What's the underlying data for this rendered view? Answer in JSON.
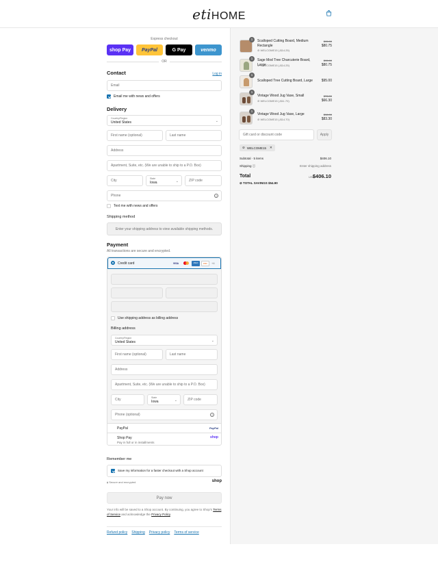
{
  "header": {
    "logo_script": "eti",
    "logo_text": "HOME",
    "cart_icon": "shopping-bag-icon"
  },
  "express": {
    "label": "Express checkout",
    "shop_pay": "shop Pay",
    "paypal": "PayPal",
    "gpay": "G Pay",
    "venmo": "venmo",
    "or": "OR"
  },
  "contact": {
    "title": "Contact",
    "login": "Log in",
    "email_placeholder": "Email",
    "newsletter": "Email me with news and offers"
  },
  "delivery": {
    "title": "Delivery",
    "country_label": "Country/Region",
    "country": "United States",
    "first_name": "First name (optional)",
    "last_name": "Last name",
    "address": "Address",
    "apartment": "Apartment, Suite, etc. (We are unable to ship to a P.O. Box)",
    "city": "City",
    "state_label": "State",
    "state": "Iowa",
    "zip": "ZIP code",
    "phone": "Phone",
    "text_me": "Text me with news and offers"
  },
  "shipping": {
    "title": "Shipping method",
    "placeholder": "Enter your shipping address to view available shipping methods."
  },
  "payment": {
    "title": "Payment",
    "subtitle": "All transactions are secure and encrypted.",
    "credit_card": "Credit card",
    "card_brands": [
      "VISA",
      "MC",
      "AMEX",
      "DISC",
      "+4"
    ],
    "use_shipping": "Use shipping address as billing address",
    "billing_title": "Billing address",
    "paypal": "PayPal",
    "paypal_logo": "PayPal",
    "shop_pay": "Shop Pay",
    "shop_pay_sub": "Pay in full or in installments",
    "shop_logo": "shop"
  },
  "billing": {
    "country_label": "Country/Region",
    "country": "United States",
    "first_name": "First name (optional)",
    "last_name": "Last name",
    "address": "Address",
    "apartment": "Apartment, Suite, etc. (We are unable to ship to a P.O. Box)",
    "city": "City",
    "state_label": "State",
    "state": "Iowa",
    "zip": "ZIP code",
    "phone": "Phone (optional)"
  },
  "remember": {
    "title": "Remember me",
    "save": "Save my information for a faster checkout with a Shop account",
    "secure": "Secure and encrypted",
    "shop": "shop"
  },
  "pay_now": "Pay now",
  "legal": {
    "text1": "Your info will be saved to a Shop account. By continuing, you agree to Shop's",
    "terms": "Terms of Service",
    "and": "and acknowledge the",
    "privacy": "Privacy Policy",
    "period": "."
  },
  "footer": [
    "Refund policy",
    "Shipping",
    "Privacy policy",
    "Terms of service"
  ],
  "cart": {
    "items": [
      {
        "qty": "1",
        "name": "Scalloped Cutting Board, Medium Rectangle",
        "discount": "WELCOME15 (-$14.25)",
        "old": "$95.00",
        "new": "$80.75"
      },
      {
        "qty": "1",
        "name": "Sage Mod Tree Charcuterie Board, Large",
        "discount": "WELCOME15 (-$14.25)",
        "old": "$95.00",
        "new": "$80.75"
      },
      {
        "qty": "1",
        "name": "Scalloped Tree Cutting Board, Large",
        "discount": "",
        "old": "",
        "new": "$95.00"
      },
      {
        "qty": "1",
        "name": "Vintage Wood Jug Vase, Small",
        "discount": "WELCOME15 (-$11.70)",
        "old": "$78.00",
        "new": "$66.30"
      },
      {
        "qty": "1",
        "name": "Vintage Wood Jug Vase, Large",
        "discount": "WELCOME15 (-$14.70)",
        "old": "$98.00",
        "new": "$83.30"
      }
    ],
    "gift_placeholder": "Gift card or discount code",
    "apply": "Apply",
    "code": "WELCOME15",
    "subtotal_label": "Subtotal · 5 items",
    "subtotal": "$406.10",
    "shipping_label": "Shipping",
    "shipping_value": "Enter shipping address",
    "total_label": "Total",
    "currency": "USD",
    "total": "$406.10",
    "savings_label": "TOTAL SAVINGS",
    "savings": "$54.90"
  },
  "colors": {
    "accent": "#1773b0",
    "shop_pay": "#5a31f4",
    "paypal": "#ffc439",
    "gpay": "#000000",
    "venmo": "#3d95ce"
  }
}
